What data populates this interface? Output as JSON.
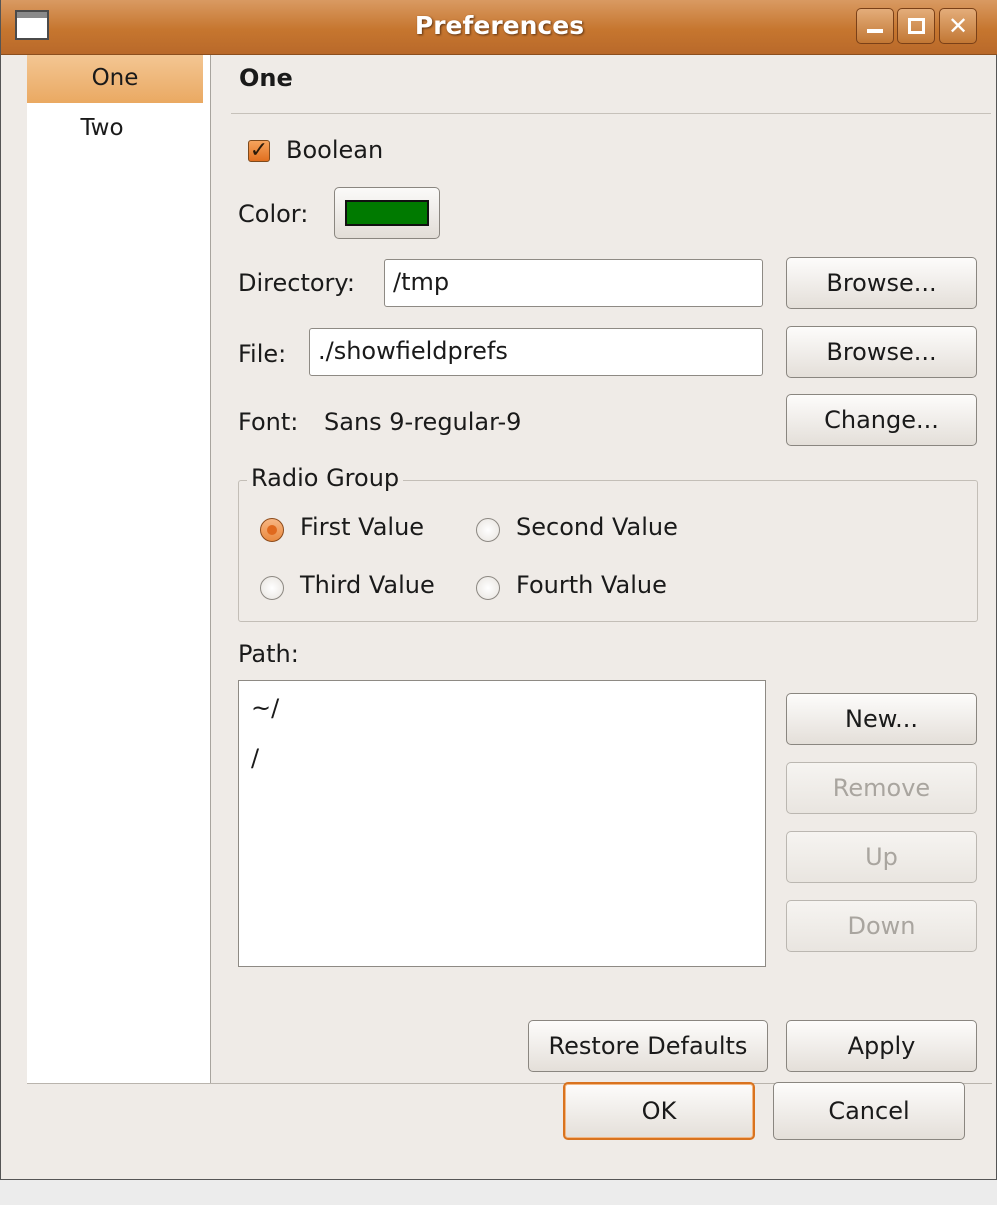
{
  "window": {
    "title": "Preferences"
  },
  "sidebar": {
    "items": [
      {
        "label": "One",
        "selected": true
      },
      {
        "label": "Two",
        "selected": false
      }
    ]
  },
  "page": {
    "heading": "One",
    "boolean_label": "Boolean",
    "boolean_checked": true,
    "color_label": "Color:",
    "color_value": "#007a00",
    "directory_label": "Directory:",
    "directory_value": "/tmp",
    "directory_browse": "Browse...",
    "file_label": "File:",
    "file_value": "./showfieldprefs",
    "file_browse": "Browse...",
    "font_label": "Font:",
    "font_value": "Sans 9-regular-9",
    "font_change": "Change...",
    "radio_group_title": "Radio Group",
    "radios": [
      {
        "label": "First Value",
        "selected": true
      },
      {
        "label": "Second Value",
        "selected": false
      },
      {
        "label": "Third Value",
        "selected": false
      },
      {
        "label": "Fourth Value",
        "selected": false
      }
    ],
    "path_label": "Path:",
    "path_items": [
      "~/",
      "/"
    ],
    "path_buttons": {
      "new": "New...",
      "remove": "Remove",
      "up": "Up",
      "down": "Down"
    },
    "restore_defaults": "Restore Defaults",
    "apply": "Apply"
  },
  "dialog_buttons": {
    "ok": "OK",
    "cancel": "Cancel"
  },
  "colors": {
    "accent": "#e0691d",
    "titlebar": "#c6762f",
    "selection": "#eaa962"
  }
}
